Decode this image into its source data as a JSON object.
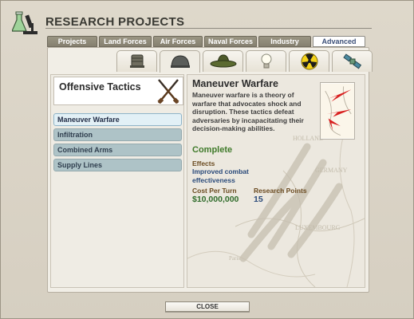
{
  "window": {
    "title": "RESEARCH PROJECTS"
  },
  "tabs": [
    {
      "label": "Projects",
      "active": false
    },
    {
      "label": "Land Forces",
      "active": false
    },
    {
      "label": "Air Forces",
      "active": false
    },
    {
      "label": "Naval Forces",
      "active": false
    },
    {
      "label": "Industry",
      "active": false
    },
    {
      "label": "Advanced",
      "active": true
    }
  ],
  "category_icons": [
    {
      "icon": "barrel-helmet-icon",
      "active": false
    },
    {
      "icon": "steel-helmet-icon",
      "active": true
    },
    {
      "icon": "campaign-hat-icon",
      "active": false
    },
    {
      "icon": "lightbulb-icon",
      "active": false
    },
    {
      "icon": "radiation-icon",
      "active": false
    },
    {
      "icon": "satellite-icon",
      "active": false
    }
  ],
  "tree": {
    "title": "Offensive Tactics",
    "icon": "crossed-rifles-icon",
    "items": [
      {
        "label": "Maneuver Warfare",
        "selected": true
      },
      {
        "label": "Infiltration",
        "selected": false
      },
      {
        "label": "Combined Arms",
        "selected": false
      },
      {
        "label": "Supply Lines",
        "selected": false
      }
    ]
  },
  "detail": {
    "title": "Maneuver Warfare",
    "description": "Maneuver warfare is a theory of warfare that advocates shock and disruption.  These tactics defeat adversaries by incapacitating their decision-making abilities.",
    "status": "Complete",
    "effects_label": "Effects",
    "effects_value": "Improved combat effectiveness",
    "cost_label": "Cost Per Turn",
    "cost_value": "$10,000,000",
    "points_label": "Research Points",
    "points_value": "15",
    "map_labels": [
      "HOLLAND",
      "GERMANY",
      "LUXEMBOURG",
      "Paris"
    ]
  },
  "footer": {
    "close_label": "CLOSE"
  },
  "colors": {
    "status_complete": "#3f7a2a",
    "label_brown": "#6a4a20",
    "value_blue": "#2a4a7a",
    "tab_active_text": "#3b4f78"
  }
}
